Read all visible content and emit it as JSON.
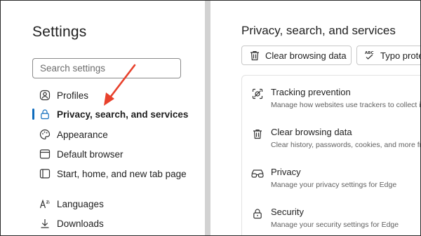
{
  "sidebar": {
    "title": "Settings",
    "search_placeholder": "Search settings",
    "items": [
      {
        "label": "Profiles"
      },
      {
        "label": "Privacy, search, and services"
      },
      {
        "label": "Appearance"
      },
      {
        "label": "Default browser"
      },
      {
        "label": "Start, home, and new tab page"
      },
      {
        "label": "Languages"
      },
      {
        "label": "Downloads"
      }
    ],
    "active_index": 1
  },
  "main": {
    "title": "Privacy, search, and services",
    "quick_actions": [
      {
        "label": "Clear browsing data",
        "icon": "trash-icon"
      },
      {
        "label": "Typo prote",
        "icon": "abc-check-icon"
      }
    ],
    "rows": [
      {
        "title": "Tracking prevention",
        "desc": "Manage how websites use trackers to collect in",
        "icon": "tracking-prevention-icon"
      },
      {
        "title": "Clear browsing data",
        "desc": "Clear history, passwords, cookies, and more fro",
        "icon": "trash-icon"
      },
      {
        "title": "Privacy",
        "desc": "Manage your privacy settings for Edge",
        "icon": "glasses-icon"
      },
      {
        "title": "Security",
        "desc": "Manage your security settings for Edge",
        "icon": "lock-icon"
      }
    ]
  },
  "colors": {
    "accent": "#0f6cbd",
    "annotation_arrow": "#e8412c",
    "divider": "#d2d2d2"
  }
}
